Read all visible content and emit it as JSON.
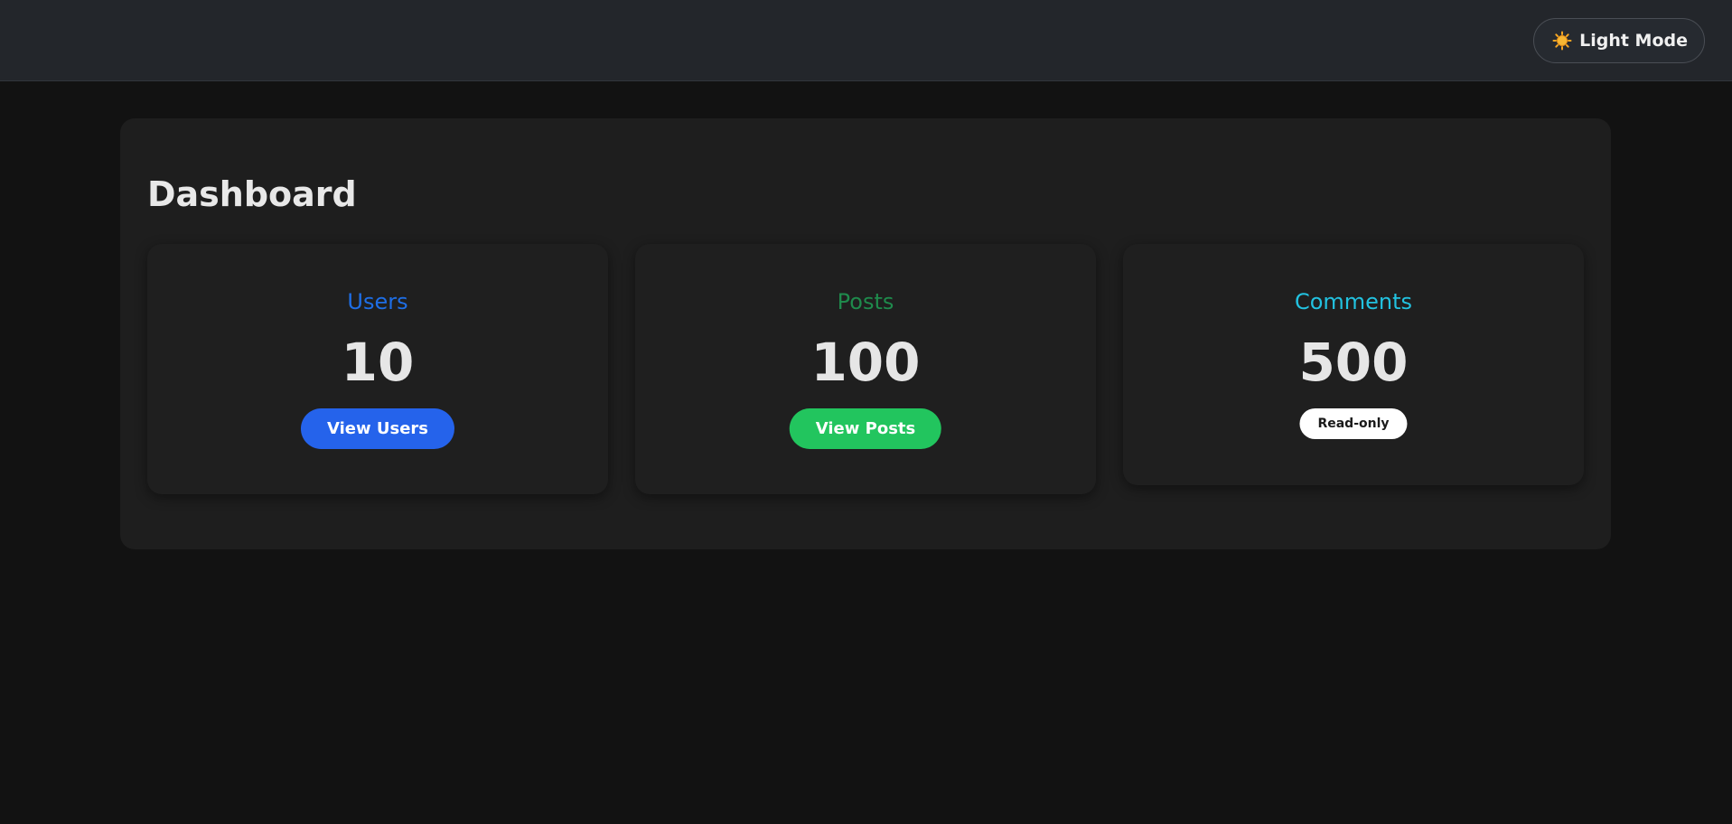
{
  "header": {
    "mode_toggle_label": "Light Mode",
    "mode_toggle_icon": "sun-icon"
  },
  "main": {
    "title": "Dashboard",
    "cards": [
      {
        "label": "Users",
        "value": "10",
        "button_label": "View Users",
        "label_color": "#1e6ee6",
        "button_color": "#2563eb"
      },
      {
        "label": "Posts",
        "value": "100",
        "button_label": "View Posts",
        "label_color": "#1f8a4c",
        "button_color": "#22c55e"
      },
      {
        "label": "Comments",
        "value": "500",
        "badge_label": "Read-only",
        "label_color": "#22c2e0"
      }
    ]
  },
  "colors": {
    "background": "#121212",
    "header_background": "#23262b",
    "panel_background": "#1e1e1e",
    "sun": "#f5a623"
  }
}
